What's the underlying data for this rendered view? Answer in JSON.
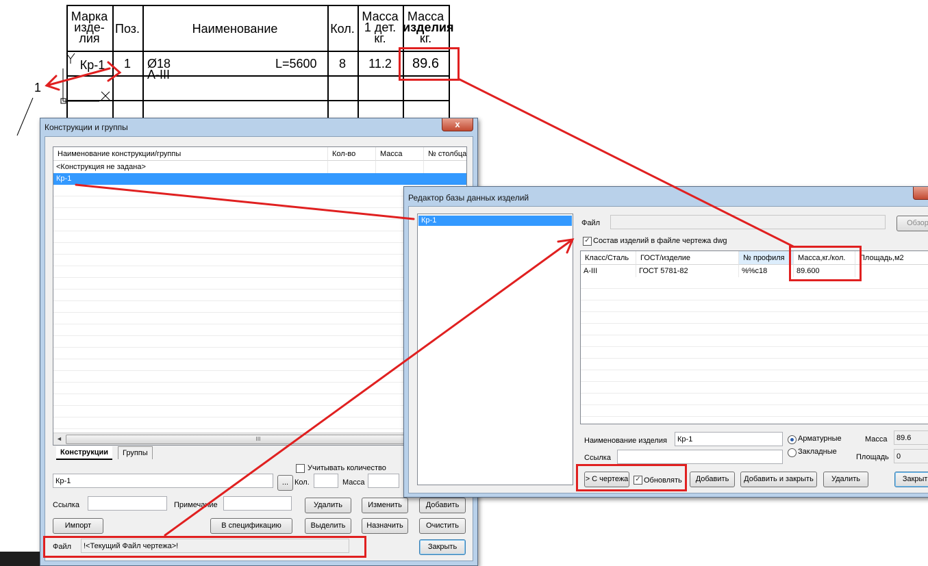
{
  "drawing_table": {
    "headers": {
      "mark": [
        "Марка",
        "изде-",
        "лия"
      ],
      "pos": "Поз.",
      "name": "Наименование",
      "qty": "Кол.",
      "mass_unit": [
        "Масса",
        "1 дет.",
        "кг."
      ],
      "mass_total": [
        "Масса",
        "изделия",
        "кг."
      ]
    },
    "row": {
      "mark": "Кр-1",
      "pos": "1",
      "name": "Ø18 A-III",
      "length": "L=5600",
      "qty": "8",
      "mass_unit": "11.2",
      "mass_total": "89.6"
    },
    "leader_number": "1"
  },
  "window_groups": {
    "title": "Конструкции и группы",
    "close": "x",
    "columns": [
      "Наименование конструкции/группы",
      "Кол-во",
      "Масса",
      "№ столбца"
    ],
    "rows": [
      "<Конструкция не задана>",
      "Кр-1"
    ],
    "selected_row": 1,
    "scroll_grip": "III",
    "tabs": [
      "Конструкции",
      "Группы"
    ],
    "count_checkbox_label": "Учитывать количество",
    "name_value": "Кр-1",
    "browse_button": "...",
    "qty_label": "Кол.",
    "mass_label": "Масса",
    "link_label": "Ссылка",
    "note_label": "Примечание",
    "buttons": {
      "delete": "Удалить",
      "edit": "Изменить",
      "add": "Добавить",
      "import": "Импорт",
      "to_spec": "В спецификацию",
      "select": "Выделить",
      "assign": "Назначить",
      "clear": "Очистить",
      "close": "Закрыть"
    },
    "file_label": "Файл",
    "file_value": "!<Текущий Файл чертежа>!"
  },
  "window_editor": {
    "title": "Редактор базы данных изделий",
    "tree_item": "Кр-1",
    "file_label": "Файл",
    "browse_button": "Обзор",
    "dwg_checkbox_label": "Состав изделий в файле чертежа dwg",
    "columns": [
      "Класс/Сталь",
      "ГОСТ/изделие",
      "№ профиля",
      "Масса,кг./кол.",
      "Площадь,м2"
    ],
    "rows": [
      [
        "A-III",
        "ГОСТ 5781-82",
        "%%c18",
        "89.600",
        ""
      ]
    ],
    "product_name_label": "Наименование изделия",
    "product_name_value": "Кр-1",
    "link_label": "Ссылка",
    "radio_rebar": "Арматурные",
    "radio_embedded": "Закладные",
    "mass_label": "Масса",
    "mass_value": "89.6",
    "area_label": "Площадь",
    "area_value": "0",
    "buttons": {
      "from_drawing": "> С чертежа",
      "update": "Обновлять",
      "add": "Добавить",
      "add_close": "Добавить и закрыть",
      "delete": "Удалить",
      "close": "Закрыть"
    }
  },
  "colors": {
    "annotation_red": "#e02020",
    "selection_blue": "#3399ff",
    "window_frame": "#b9d1ea"
  }
}
